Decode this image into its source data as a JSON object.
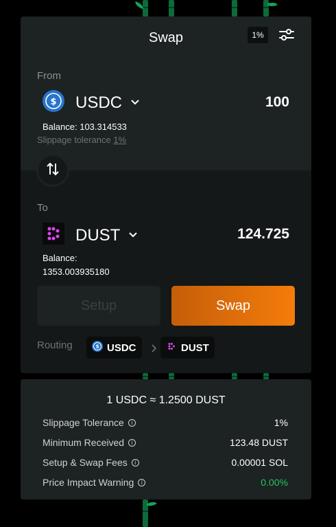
{
  "colors": {
    "accent_orange": "#f57c0b",
    "positive_green": "#22c55e",
    "card_bg": "#1d2222"
  },
  "swap": {
    "title": "Swap",
    "slippage_badge": "1%",
    "settings_icon": "sliders-icon",
    "from": {
      "label": "From",
      "token": "USDC",
      "token_icon": "usdc-icon",
      "amount": "100",
      "balance_label": "Balance:",
      "balance_value": "103.314533",
      "slippage_label": "Slippage tolerance",
      "slippage_value": "1%"
    },
    "switch_icon": "swap-arrows-icon",
    "to": {
      "label": "To",
      "token": "DUST",
      "token_icon": "dust-icon",
      "amount": "124.725",
      "balance_label": "Balance:",
      "balance_value": "1353.003935180"
    },
    "setup_button": "Setup",
    "swap_button": "Swap",
    "routing": {
      "label": "Routing",
      "path": [
        "USDC",
        "DUST"
      ]
    }
  },
  "info": {
    "rate": "1 USDC ≈ 1.2500 DUST",
    "rows": [
      {
        "label": "Slippage Tolerance",
        "value": "1%"
      },
      {
        "label": "Minimum Received",
        "value": "123.48 DUST"
      },
      {
        "label": "Setup & Swap Fees",
        "value": "0.00001 SOL"
      },
      {
        "label": "Price Impact Warning",
        "value": "0.00%"
      }
    ]
  }
}
